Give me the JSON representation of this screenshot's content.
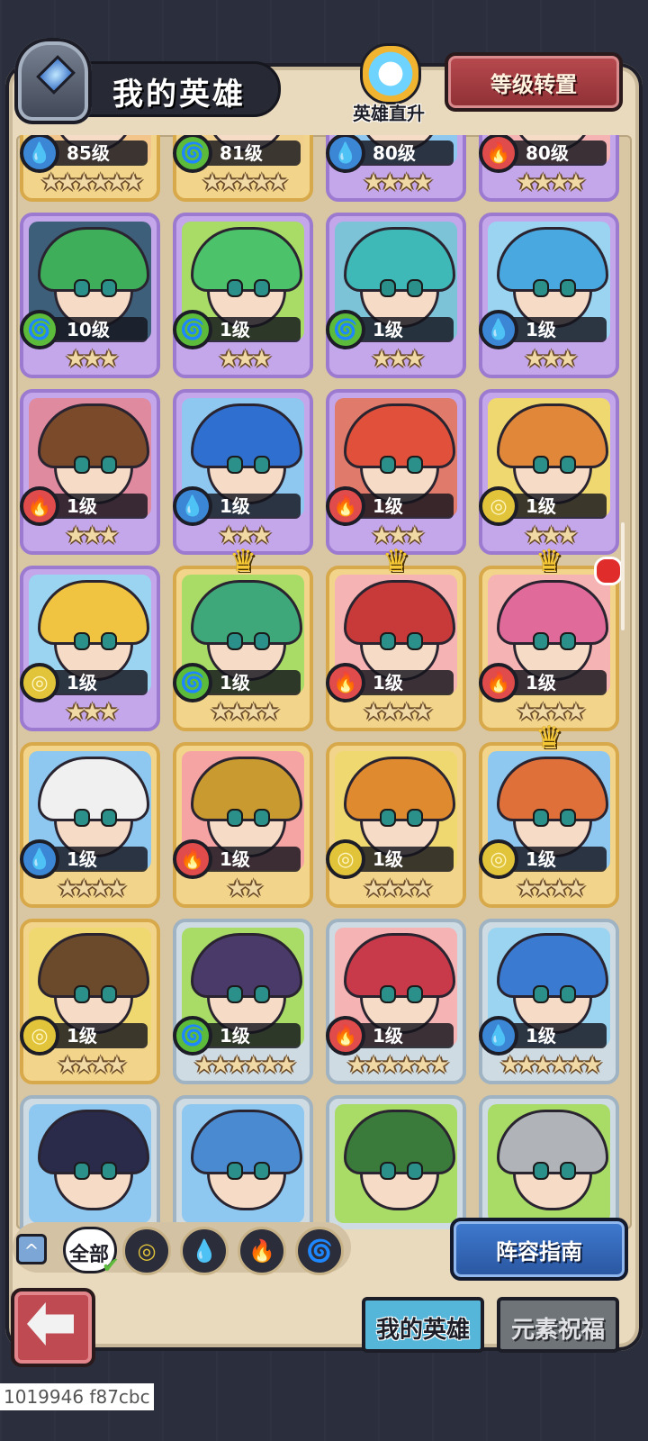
{
  "header": {
    "title": "我的英雄",
    "rise_label": "英雄直升",
    "reset_label": "等级转置"
  },
  "heroes": [
    {
      "level": "85级",
      "element": "water",
      "stars": "★★★★★★",
      "frame": "gold",
      "hair": "#8a5a3a",
      "bg": "#f4c58a"
    },
    {
      "level": "81级",
      "element": "wind",
      "stars": "★★★★★",
      "frame": "gold",
      "hair": "#a07040",
      "bg": "#f0d08a"
    },
    {
      "level": "80级",
      "element": "water",
      "stars": "★★★★",
      "frame": "purple",
      "hair": "#4a7bd0",
      "bg": "#8ec8f0"
    },
    {
      "level": "80级",
      "element": "fire",
      "stars": "★★★★",
      "frame": "purple",
      "hair": "#d84a4a",
      "bg": "#f5b3b3"
    },
    {
      "level": "10级",
      "element": "wind",
      "stars": "★★★",
      "frame": "purple",
      "hair": "#3fae5a",
      "bg": "#3e5f7a"
    },
    {
      "level": "1级",
      "element": "wind",
      "stars": "★★★",
      "frame": "purple",
      "hair": "#4cc36a",
      "bg": "#a8dc66"
    },
    {
      "level": "1级",
      "element": "wind",
      "stars": "★★★",
      "frame": "purple",
      "hair": "#3fb8b8",
      "bg": "#7cc3d8"
    },
    {
      "level": "1级",
      "element": "water",
      "stars": "★★★",
      "frame": "purple",
      "hair": "#4aa8e0",
      "bg": "#9ad4f0"
    },
    {
      "level": "1级",
      "element": "fire",
      "stars": "★★★",
      "frame": "purple",
      "hair": "#7a4a2a",
      "bg": "#e08aa0"
    },
    {
      "level": "1级",
      "element": "water",
      "stars": "★★★",
      "frame": "purple",
      "hair": "#2f6fd0",
      "bg": "#8ec8f0"
    },
    {
      "level": "1级",
      "element": "fire",
      "stars": "★★★",
      "frame": "purple",
      "hair": "#e0503a",
      "bg": "#e07a6a"
    },
    {
      "level": "1级",
      "element": "earth",
      "stars": "★★★",
      "frame": "purple",
      "hair": "#e0873a",
      "bg": "#f0d870"
    },
    {
      "level": "1级",
      "element": "earth",
      "stars": "★★★",
      "frame": "purple",
      "hair": "#f0c440",
      "bg": "#9ad4f0"
    },
    {
      "level": "1级",
      "element": "wind",
      "stars": "★★★★",
      "frame": "gold",
      "hair": "#3fa87a",
      "bg": "#a8dc66",
      "crown": true
    },
    {
      "level": "1级",
      "element": "fire",
      "stars": "★★★★",
      "frame": "gold",
      "hair": "#c83a3a",
      "bg": "#f5b3b3",
      "crown": true
    },
    {
      "level": "1级",
      "element": "fire",
      "stars": "★★★★",
      "frame": "gold",
      "hair": "#e06a9a",
      "bg": "#f5b3b3",
      "crown": true,
      "dot": true
    },
    {
      "level": "1级",
      "element": "water",
      "stars": "★★★★",
      "frame": "gold",
      "hair": "#f0f0f0",
      "bg": "#8ec8f0"
    },
    {
      "level": "1级",
      "element": "fire",
      "stars": "★★",
      "frame": "gold",
      "hair": "#c89a30",
      "bg": "#f5a3a3"
    },
    {
      "level": "1级",
      "element": "earth",
      "stars": "★★★★",
      "frame": "gold",
      "hair": "#e08a30",
      "bg": "#f0d870"
    },
    {
      "level": "1级",
      "element": "earth",
      "stars": "★★★★",
      "frame": "gold",
      "hair": "#e0703a",
      "bg": "#8ec8f0",
      "crown": true
    },
    {
      "level": "1级",
      "element": "earth",
      "stars": "★★★★",
      "frame": "gold",
      "hair": "#6a4a2a",
      "bg": "#f0d870"
    },
    {
      "level": "1级",
      "element": "wind",
      "stars": "★★★★★★",
      "frame": "silver",
      "hair": "#4a3a6a",
      "bg": "#a8dc66"
    },
    {
      "level": "1级",
      "element": "fire",
      "stars": "★★★★★★",
      "frame": "silver",
      "hair": "#c83a4a",
      "bg": "#f5b3b3"
    },
    {
      "level": "1级",
      "element": "water",
      "stars": "★★★★★★",
      "frame": "silver",
      "hair": "#3a7ad0",
      "bg": "#9ad4f0"
    },
    {
      "level": "",
      "element": "",
      "stars": "",
      "frame": "silver",
      "hair": "#2a2a4a",
      "bg": "#8ec8f0"
    },
    {
      "level": "",
      "element": "",
      "stars": "",
      "frame": "silver",
      "hair": "#4a8ad0",
      "bg": "#8ec8f0"
    },
    {
      "level": "",
      "element": "",
      "stars": "",
      "frame": "silver",
      "hair": "#3a7a3a",
      "bg": "#a8dc66"
    },
    {
      "level": "",
      "element": "",
      "stars": "",
      "frame": "silver",
      "hair": "#b0b4b8",
      "bg": "#a8dc66"
    }
  ],
  "element_glyphs": {
    "water": "💧",
    "fire": "🔥",
    "wind": "🌀",
    "earth": "◎"
  },
  "filters": {
    "all_label": "全部",
    "elements": [
      "earth",
      "water",
      "fire",
      "wind"
    ]
  },
  "guide_label": "阵容指南",
  "tabs": {
    "my_heroes": "我的英雄",
    "blessing": "元素祝福"
  },
  "watermark": "1019946 f87cbc"
}
